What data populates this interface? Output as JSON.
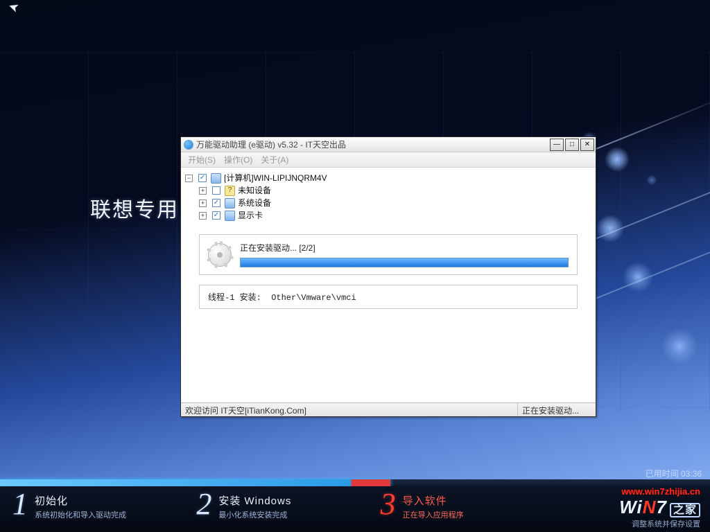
{
  "wallpaper_text": "联想专用  G",
  "elapsed_label": "已用时间",
  "elapsed_time": "03:36",
  "watermark_url": "www.win7zhijia.cn",
  "logo": {
    "brand": "WiN7",
    "suffix": "之家",
    "sub": "调整系统并保存设置"
  },
  "big_progress_percent": 55,
  "dialog": {
    "title": "万能驱动助理 (e驱动) v5.32 - IT天空出品",
    "menus": {
      "start": "开始(S)",
      "action": "操作(O)",
      "about": "关于(A)"
    },
    "tree": {
      "root": {
        "label": "[计算机]WIN-LIPIJNQRM4V",
        "checked": true,
        "expanded": true
      },
      "nodes": [
        {
          "id": "unknown",
          "label": "未知设备",
          "checked": false
        },
        {
          "id": "system",
          "label": "系统设备",
          "checked": true
        },
        {
          "id": "display",
          "label": "显示卡",
          "checked": true
        }
      ]
    },
    "progress": {
      "label": "正在安装驱动... [2/2]",
      "percent": 100
    },
    "log_line": "线程-1 安装:  Other\\Vmware\\vmci",
    "statusbar": {
      "left": "欢迎访问 IT天空[iTianKong.Com]",
      "right": "正在安装驱动..."
    }
  },
  "steps": [
    {
      "num": "1",
      "title": "初始化",
      "sub": "系统初始化和导入驱动完成",
      "active": false
    },
    {
      "num": "2",
      "title": "安装 Windows",
      "sub": "最小化系统安装完成",
      "active": false
    },
    {
      "num": "3",
      "title": "导入软件",
      "sub": "正在导入应用程序",
      "active": true
    },
    {
      "num": "4",
      "title": "",
      "sub": "",
      "active": false
    }
  ]
}
